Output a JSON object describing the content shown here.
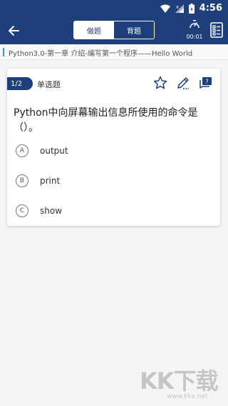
{
  "status_bar": {
    "time": "4:56"
  },
  "app_bar": {
    "tabs": [
      {
        "label": "做题",
        "active": true
      },
      {
        "label": "背题",
        "active": false
      }
    ],
    "timer": "00:01"
  },
  "chapter": {
    "title": "Python3.0-第一章 介绍-编写第一个程序——Hello World"
  },
  "card": {
    "number": "1/2",
    "type": "单选题",
    "question": "Python中向屏幕输出信息所使用的命令是（）。",
    "options": [
      {
        "letter": "A",
        "text": "output"
      },
      {
        "letter": "B",
        "text": "print"
      },
      {
        "letter": "C",
        "text": "show"
      }
    ]
  },
  "watermark": {
    "logo": "KK下载",
    "url": "www.kkx.net"
  },
  "colors": {
    "primary": "#1e3f7a",
    "accent": "#2a9fd6",
    "background": "#f4f5f7"
  },
  "icons": {
    "status": [
      "wifi-icon",
      "signal-icon",
      "battery-icon"
    ],
    "app_bar": [
      "back-arrow-icon",
      "timer-icon",
      "answer-sheet-icon"
    ],
    "card_tools": [
      "star-icon",
      "pencil-icon",
      "feedback-icon"
    ]
  }
}
